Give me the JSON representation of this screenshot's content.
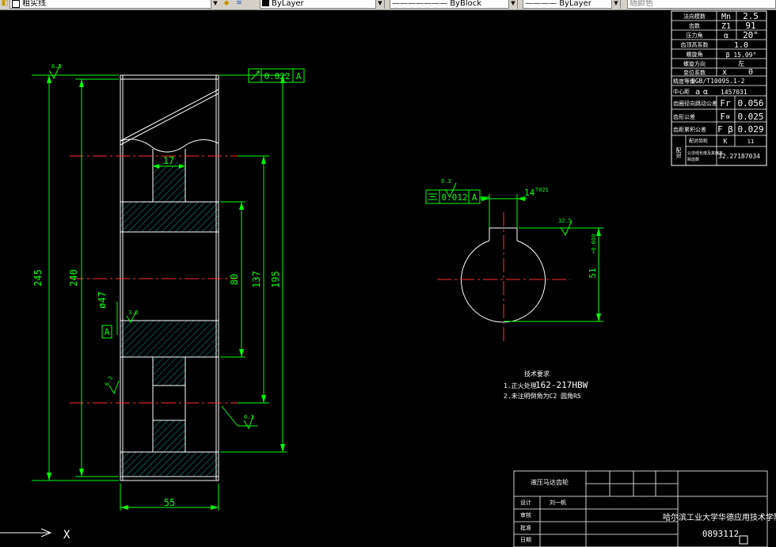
{
  "toolbar": {
    "layer_name": "粗实线",
    "color": "ByLayer",
    "linetype_line": "———————",
    "linetype": "ByBlock",
    "lineweight_line": "————",
    "lineweight": "ByLayer",
    "plot_style": "随颜色"
  },
  "params": [
    {
      "label": "法向模数",
      "sym": "Mn",
      "val": "2.5"
    },
    {
      "label": "齿数",
      "sym": "Z1",
      "val": "91"
    },
    {
      "label": "压力角",
      "sym": "α",
      "val": "20°"
    },
    {
      "label": "齿顶高系数",
      "sym": "",
      "val": "1.0"
    },
    {
      "label": "螺旋角",
      "sym": "",
      "val": "β 15.09°"
    },
    {
      "label": "螺旋方向",
      "sym": "",
      "val": "左"
    },
    {
      "label": "变位系数",
      "sym": "x",
      "val": "0"
    }
  ],
  "precision": {
    "label": "精度等级",
    "val": "9GB/T10095.1-2"
  },
  "center": {
    "label": "中心距",
    "a": "a",
    "b": "α",
    "val": "1457031"
  },
  "tolerances": [
    {
      "label": "齿圈径向跳动公差",
      "sym": "Fr",
      "val": "0.056"
    },
    {
      "label": "齿形公差",
      "sym": "F∝",
      "val": "0.025"
    },
    {
      "label": "齿距累积公差",
      "sym": "F β",
      "val": "0.029"
    }
  ],
  "pairing": {
    "group": "配对",
    "row1_label": "配对齿轮",
    "row1_sym": "K",
    "row1_val": "11",
    "row2_label": "公法线长度及其偏差",
    "row2_sub": "跨齿数",
    "row2_val": "32.27187034"
  },
  "dims": {
    "d245": "245",
    "d240": "240",
    "d80": "80",
    "d137": "137",
    "d195": "195",
    "d47": "ø47",
    "d17": "17",
    "d55": "55",
    "d14": "14",
    "d14_tol": "T021",
    "d51": "51",
    "d51_tol": "+0.000",
    "r63a": "6.3",
    "r32": "3.2",
    "r63b": "6.3",
    "r63c": "6.3",
    "r63d": "6.3",
    "r125": "12.5",
    "datum": "A"
  },
  "fcf1": {
    "tol": "0.022",
    "datum": "A"
  },
  "fcf2": {
    "tol": "0.012",
    "datum": "A"
  },
  "notes": {
    "title": "技术要求",
    "line1_prefix": "1.正火处理",
    "line1": "162-217HBW",
    "line2_prefix": "2.未注明倒角为C2",
    "line2_suffix": "圆角R5"
  },
  "titleblock": {
    "part_name": "液压马达齿轮",
    "design_label": "设计",
    "designer": "刘一帆",
    "check_label": "审核",
    "review_label": "批准",
    "date_label": "日期",
    "school": "哈尔滨工业大学华德应用技术学院",
    "number": "0893112"
  },
  "ucs": {
    "x": "X"
  }
}
